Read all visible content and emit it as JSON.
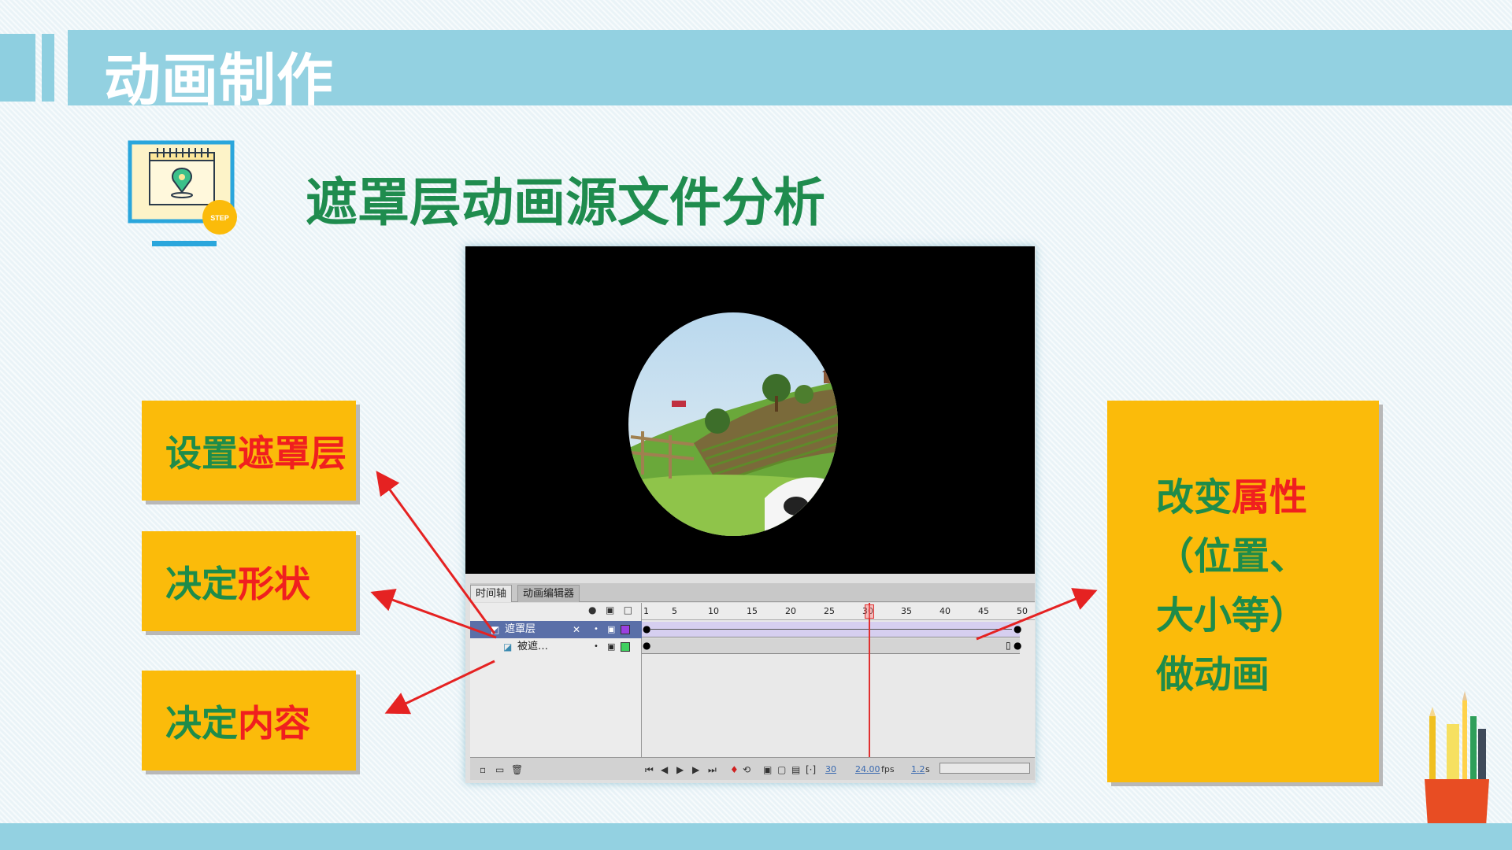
{
  "header": {
    "title": "动画制作"
  },
  "step_icon": {
    "badge": "STEP"
  },
  "subtitle": "遮罩层动画源文件分析",
  "left_labels": [
    {
      "green": "设置",
      "red": "遮罩层"
    },
    {
      "green": "决定",
      "red": "形状"
    },
    {
      "green": "决定",
      "red": "内容"
    }
  ],
  "right_label": {
    "line1_green": "改变",
    "line1_red": "属性",
    "line2": "（位置、",
    "line3": "大小等）",
    "line4": "做动画"
  },
  "timeline": {
    "tabs": [
      "时间轴",
      "动画编辑器"
    ],
    "ruler": [
      "1",
      "5",
      "10",
      "15",
      "20",
      "25",
      "30",
      "35",
      "40",
      "45",
      "50"
    ],
    "layers": [
      {
        "name": "遮罩层",
        "type": "mask"
      },
      {
        "name": "被遮…",
        "type": "masked"
      }
    ],
    "current_frame": "30",
    "fps": "24.00",
    "fps_unit": "fps",
    "time": "1.2",
    "time_unit": "s"
  },
  "colors": {
    "accent_blue": "#93d1e1",
    "box_yellow": "#fbbb0a",
    "text_green": "#1e8c4a",
    "text_red": "#f01f1f"
  }
}
